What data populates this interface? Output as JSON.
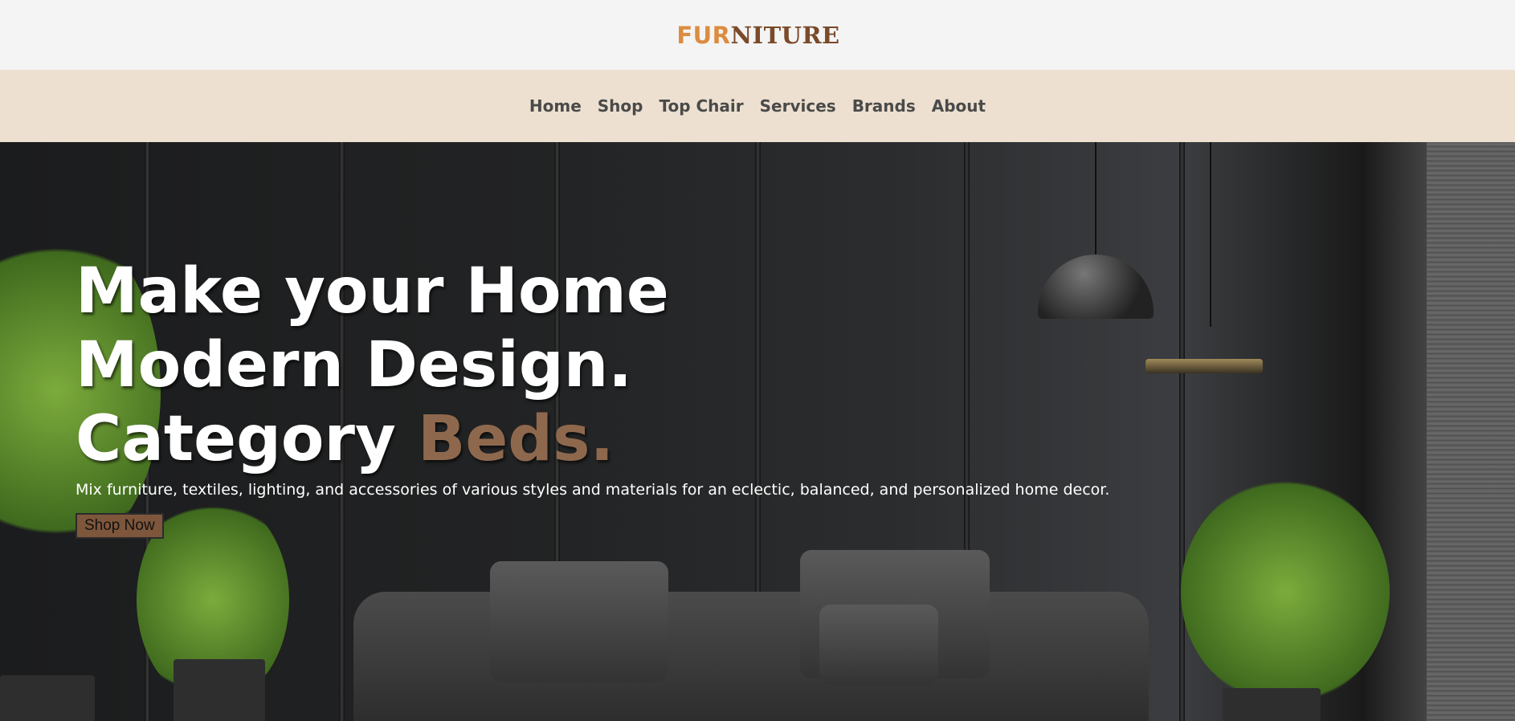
{
  "header": {
    "logo_part1": "FUR",
    "logo_part2": "NITURE"
  },
  "nav": {
    "items": [
      "Home",
      "Shop",
      "Top Chair",
      "Services",
      "Brands",
      "About"
    ]
  },
  "hero": {
    "line1": "Make your Home",
    "line2": "Modern Design.",
    "line3_prefix": "Category ",
    "line3_accent": "Beds.",
    "description": "Mix furniture, textiles, lighting, and accessories of various styles and materials for an eclectic, balanced, and personalized home decor.",
    "cta": "Shop Now"
  },
  "colors": {
    "logo_accent": "#dc8c3f",
    "logo_main": "#7a4a2a",
    "nav_bg": "#ede0d0",
    "accent": "#8e684d",
    "button": "#7e563b"
  }
}
